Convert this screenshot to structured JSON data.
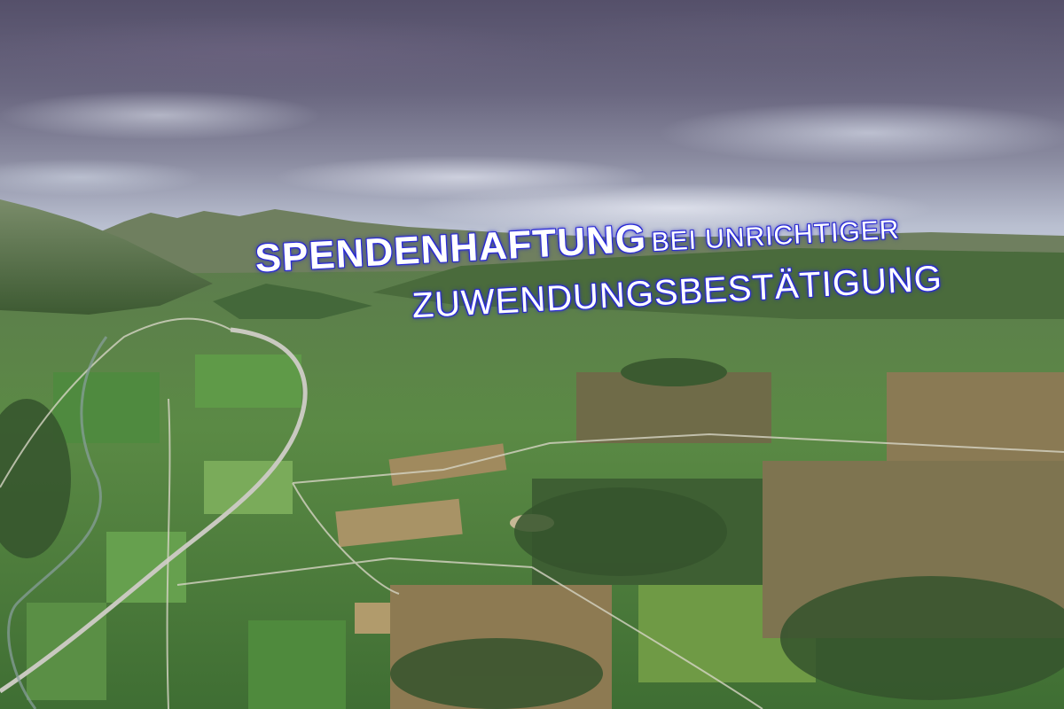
{
  "title": {
    "line1_big": "SPENDENHAFTUNG",
    "line1_small": "BEI UNRICHTIGER",
    "line2": "ZUWENDUNGSBESTÄTIGUNG"
  },
  "colors": {
    "text": "#ffffff",
    "text_outline": "#2a2ad8",
    "sky_top": "#55506a",
    "field_green": "#4e8a3a",
    "mountain": "#4f6a3f"
  }
}
